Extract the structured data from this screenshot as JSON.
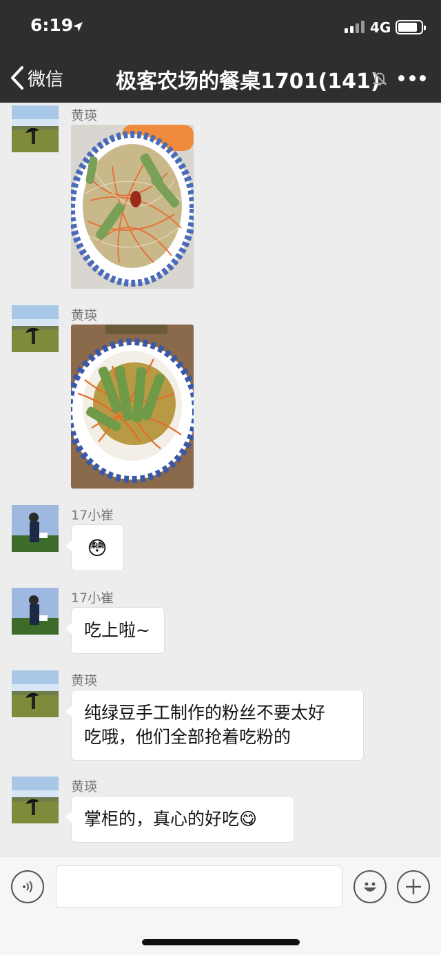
{
  "status_bar": {
    "time": "6:19",
    "network": "4G"
  },
  "nav": {
    "back_label": "微信",
    "title": "极客农场的餐桌1701(141)"
  },
  "messages": [
    {
      "sender": "黄瑛",
      "type": "image",
      "image_desc": "stir-fried mung bean noodles with carrot and yuba"
    },
    {
      "sender": "黄瑛",
      "type": "image",
      "image_desc": "yuba with carrot strips on blue-patterned plate"
    },
    {
      "sender": "17小崔",
      "type": "emoji",
      "emoji": "😳"
    },
    {
      "sender": "17小崔",
      "type": "text",
      "text": "吃上啦~"
    },
    {
      "sender": "黄瑛",
      "type": "text",
      "line1": "纯绿豆手工制作的粉丝不要太好",
      "line2": "吃哦，他们全部抢着吃粉的"
    },
    {
      "sender": "黄瑛",
      "type": "text",
      "text": "掌柜的，真心的好吃",
      "emoji": "😋"
    }
  ],
  "input_bar": {
    "placeholder": ""
  },
  "icons": {
    "back": "chevron-left-icon",
    "mute": "bell-slash-icon",
    "more": "ellipsis-icon",
    "voice": "voice-icon",
    "emoji": "smiley-icon",
    "plus": "plus-icon"
  },
  "colors": {
    "nav_bg": "#2e2e2e",
    "chat_bg": "#ededed",
    "bubble_bg": "#ffffff"
  }
}
